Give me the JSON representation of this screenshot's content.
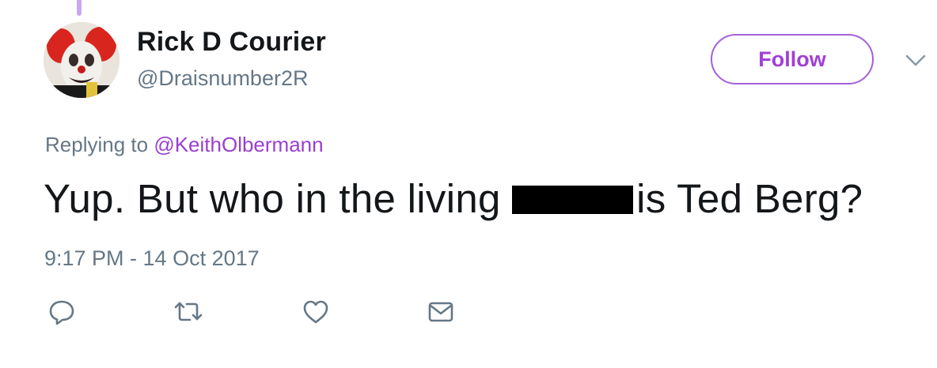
{
  "tweet": {
    "author": {
      "display_name": "Rick D Courier",
      "handle": "@Draisnumber2R",
      "avatar_icon": "clown-avatar"
    },
    "follow_label": "Follow",
    "replying_prefix": "Replying to",
    "replying_to": "@KeithOlbermann",
    "text_before_redaction": "Yup. But who in the living",
    "text_after_redaction": "is Ted Berg?",
    "timestamp": "9:17 PM - 14 Oct 2017"
  },
  "actions": [
    {
      "name": "reply",
      "icon": "reply-icon"
    },
    {
      "name": "retweet",
      "icon": "retweet-icon"
    },
    {
      "name": "like",
      "icon": "heart-icon"
    },
    {
      "name": "direct-message",
      "icon": "envelope-icon"
    }
  ],
  "colors": {
    "accent": "#a03fd6",
    "thread_line": "#c8a8f0",
    "secondary_text": "#657786",
    "icon_gray": "#657786"
  }
}
